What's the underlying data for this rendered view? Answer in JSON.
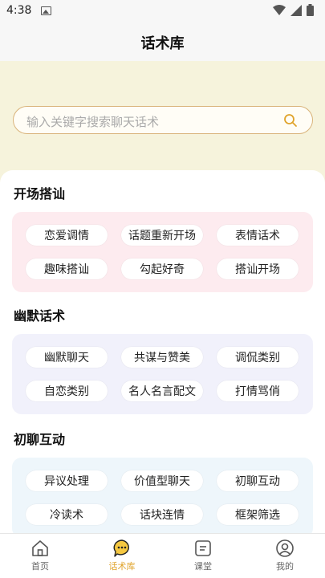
{
  "status": {
    "time": "4:38"
  },
  "header": {
    "title": "话术库"
  },
  "search": {
    "placeholder": "输入关键字搜索聊天话术"
  },
  "sections": [
    {
      "title": "开场搭讪",
      "chips": [
        "恋爱调情",
        "话题重新开场",
        "表情话术",
        "趣味搭讪",
        "勾起好奇",
        "搭讪开场"
      ]
    },
    {
      "title": "幽默话术",
      "chips": [
        "幽默聊天",
        "共谋与赞美",
        "调侃类别",
        "自恋类别",
        "名人名言配文",
        "打情骂俏"
      ]
    },
    {
      "title": "初聊互动",
      "chips": [
        "异议处理",
        "价值型聊天",
        "初聊互动",
        "冷读术",
        "话块连情",
        "框架筛选"
      ]
    }
  ],
  "tabbar": {
    "items": [
      {
        "label": "首页",
        "icon": "home-icon",
        "active": false
      },
      {
        "label": "话术库",
        "icon": "chat-bubble-icon",
        "active": true
      },
      {
        "label": "课堂",
        "icon": "notebook-icon",
        "active": false
      },
      {
        "label": "我的",
        "icon": "profile-icon",
        "active": false
      }
    ]
  },
  "colors": {
    "accent": "#e0a32a",
    "background": "#f6f3dc",
    "search_border": "#d9b37a"
  }
}
